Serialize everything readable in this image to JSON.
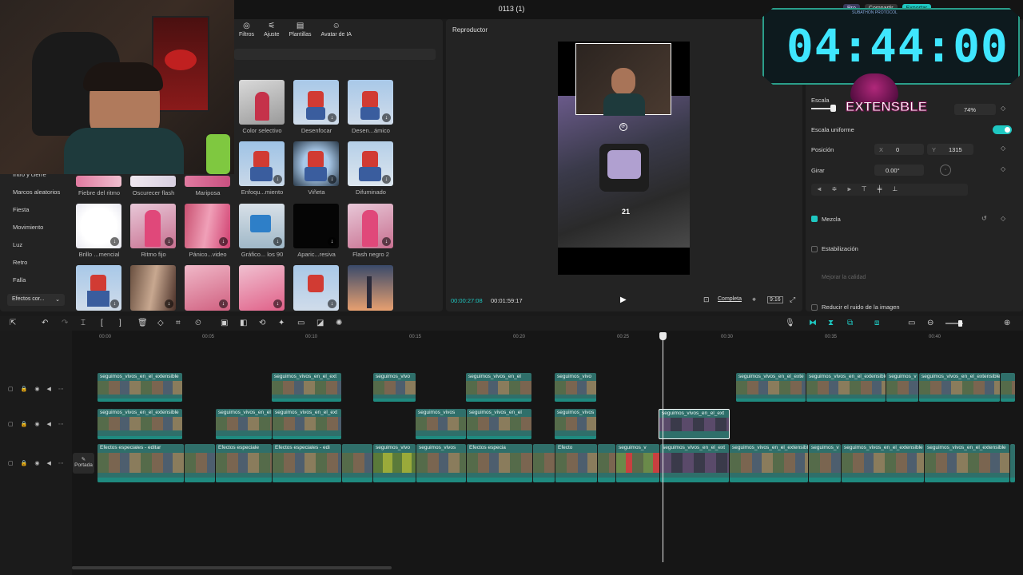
{
  "window": {
    "title": "0113 (1)"
  },
  "header_buttons": {
    "pro": "Pro",
    "share": "Compartir",
    "export": "Exportar"
  },
  "left_panel": {
    "toolbar": [
      {
        "icon": "filters-icon",
        "label": "Filtros"
      },
      {
        "icon": "adjust-icon",
        "label": "Ajuste"
      },
      {
        "icon": "templates-icon",
        "label": "Plantillas"
      },
      {
        "icon": "ai-avatar-icon",
        "label": "Avatar de IA"
      }
    ],
    "categories": [
      "Intro y cierre",
      "Marcos aleatorios",
      "Fiesta",
      "Movimiento",
      "Luz",
      "Retro",
      "Falla"
    ],
    "category_dropdown": "Efectos cor...",
    "effects_rows": [
      [
        "Color selectivo",
        "Desenfocar",
        "Desen...ámico"
      ],
      [
        "Enfoqu...miento",
        "Viñeta",
        "Difuminado"
      ],
      [
        "Fiebre del ritmo",
        "Oscurecer flash",
        "Mariposa"
      ],
      [
        "Brillo ...mencial",
        "Ritmo fijo",
        "Pánico...video",
        "Gráfico... los 90",
        "Aparic...resiva",
        "Flash negro 2"
      ]
    ]
  },
  "player": {
    "title": "Reproductor",
    "current_time": "00:00:27:08",
    "total_time": "00:01:59:17",
    "quality_label": "Completa",
    "ratio_label": "9:16",
    "hud_number": "21"
  },
  "stream_overlay": {
    "timer": "04:44:00",
    "banner": "SUBATHON PROTOCOL",
    "badge": "EXTENSBLE"
  },
  "inspector": {
    "scale_label": "Escala",
    "scale_value": "74%",
    "scale_fraction": 0.74,
    "uniform_scale_label": "Escala uniforme",
    "uniform_scale_on": true,
    "position_label": "Posición",
    "pos_x_label": "X",
    "pos_x": "0",
    "pos_y_label": "Y",
    "pos_y": "1315",
    "rotate_label": "Girar",
    "rotate_value": "0.00°",
    "blend_label": "Mezcla",
    "stabilize_label": "Estabilización",
    "improve_quality_label": "Mejorar la calidad",
    "reduce_noise_label": "Reducir el ruido de la imagen"
  },
  "timeline": {
    "ruler": [
      "00:00",
      "00:05",
      "00:10",
      "00:15",
      "00:20",
      "00:25",
      "00:30",
      "00:35",
      "00:40"
    ],
    "cover_label": "Portada",
    "clip_name": "seguimos_vivos_en_el_extensible",
    "clip_names_short": [
      "seguimos_vivos_en_el_extensible",
      "seguimos_vivos_en_el_ext",
      "seguimos_vivo",
      "seguimos_vivos_en_el",
      "seguimos_vivos",
      "seguimos_v",
      "seguimos_vivos_en_el_exte"
    ],
    "effect_names": [
      "Efectos especiales - editar",
      "Efectos especiale",
      "Efectos especiales - edi",
      "Efectos especia",
      "Efecto"
    ],
    "zoom_level": 0.7
  },
  "colors": {
    "accent": "#1fc7c1",
    "clip_teal": "#2f6f6a",
    "timer_cyan": "#3fe6ff"
  }
}
